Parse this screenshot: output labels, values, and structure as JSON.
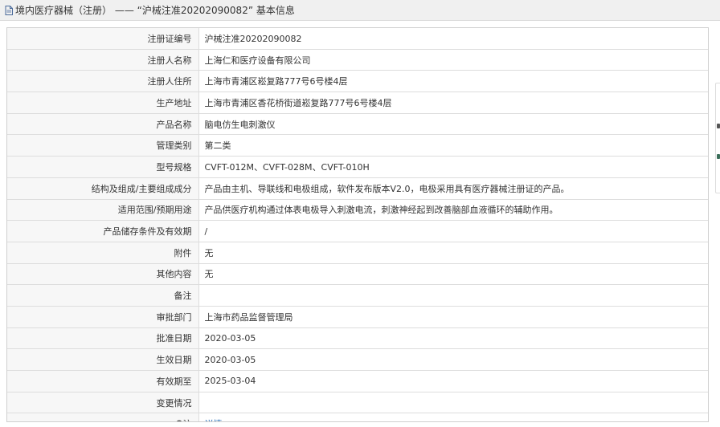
{
  "header": {
    "title": "境内医疗器械（注册） —— “沪械注准20202090082” 基本信息"
  },
  "rows": [
    {
      "label": "注册证编号",
      "value": "沪械注准20202090082"
    },
    {
      "label": "注册人名称",
      "value": "上海仁和医疗设备有限公司"
    },
    {
      "label": "注册人住所",
      "value": "上海市青浦区崧复路777号6号楼4层"
    },
    {
      "label": "生产地址",
      "value": "上海市青浦区香花桥街道崧复路777号6号楼4层"
    },
    {
      "label": "产品名称",
      "value": "脑电仿生电刺激仪"
    },
    {
      "label": "管理类别",
      "value": "第二类"
    },
    {
      "label": "型号规格",
      "value": "CVFT-012M、CVFT-028M、CVFT-010H"
    },
    {
      "label": "结构及组成/主要组成成分",
      "value": "产品由主机、导联线和电极组成，软件发布版本V2.0，电极采用具有医疗器械注册证的产品。"
    },
    {
      "label": "适用范围/预期用途",
      "value": "产品供医疗机构通过体表电极导入刺激电流，刺激神经起到改善脑部血液循环的辅助作用。"
    },
    {
      "label": "产品储存条件及有效期",
      "value": "/"
    },
    {
      "label": "附件",
      "value": "无"
    },
    {
      "label": "其他内容",
      "value": "无"
    },
    {
      "label": "备注",
      "value": ""
    },
    {
      "label": "审批部门",
      "value": "上海市药品监督管理局"
    },
    {
      "label": "批准日期",
      "value": "2020-03-05"
    },
    {
      "label": "生效日期",
      "value": "2020-03-05"
    },
    {
      "label": "有效期至",
      "value": "2025-03-04"
    },
    {
      "label": "变更情况",
      "value": ""
    }
  ],
  "note_row": {
    "label": "注",
    "link_text": "详情"
  },
  "colors": {
    "header_bg": "#f0f0f0",
    "label_bg": "#f7f7f7",
    "border": "#dddddd",
    "link": "#1a66b3"
  }
}
